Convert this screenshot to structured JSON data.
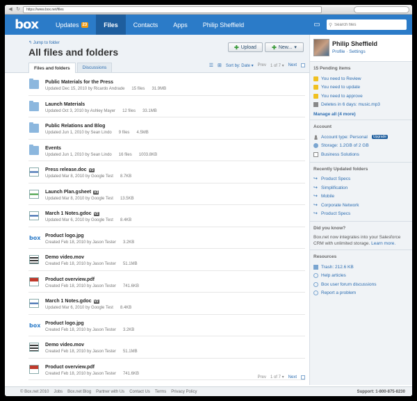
{
  "browser": {
    "url": "https://www.box.net/files"
  },
  "nav": {
    "logo": "box",
    "items": [
      {
        "label": "Updates",
        "badge": "23"
      },
      {
        "label": "Files"
      },
      {
        "label": "Contacts"
      },
      {
        "label": "Apps"
      },
      {
        "label": "Philip Sheffield"
      }
    ],
    "search_placeholder": "Search files"
  },
  "header": {
    "jump": "Jump to folder",
    "title": "All files and folders",
    "upload_label": "Upload",
    "new_label": "New...",
    "tabs": [
      "Files and folders",
      "Discussions"
    ],
    "sort_label": "Sort by: Date",
    "pager_prev": "Prev",
    "pager_page": "1 of 7",
    "pager_next": "Next"
  },
  "files": [
    {
      "name": "Public Materials for the Press",
      "meta": "Updated Dec 15, 2010 by Ricardo Andrade",
      "count": "15 files",
      "size": "31.9MB",
      "type": "folder"
    },
    {
      "name": "Launch Materials",
      "meta": "Updated Oct 3, 2010 by Ashley Mayer",
      "count": "12 files",
      "size": "33.1MB",
      "type": "folder"
    },
    {
      "name": "Public Relations and Blog",
      "meta": "Updated Jun 1, 2010 by Sean Lindo",
      "count": "9 files",
      "size": "4.5MB",
      "type": "folder"
    },
    {
      "name": "Events",
      "meta": "Updated Jun 1, 2010 by Sean Lindo",
      "count": "16 files",
      "size": "1003.8KB",
      "type": "folder"
    },
    {
      "name": "Press release.doc",
      "version": "V3",
      "meta": "Updated Mar 8, 2010 by Google Test",
      "size": "8.7KB",
      "type": "word"
    },
    {
      "name": "Launch Plan.gsheet",
      "version": "V3",
      "meta": "Updated Mar 8, 2010 by Google Test",
      "size": "13.5KB",
      "type": "sheet"
    },
    {
      "name": "March 1 Notes.gdoc",
      "version": "V2",
      "meta": "Updated Mar 6, 2010 by Google Test",
      "size": "8.4KB",
      "type": "word"
    },
    {
      "name": "Product logo.jpg",
      "meta": "Created Feb 18, 2010 by Jason Tester",
      "size": "3.2KB",
      "type": "box"
    },
    {
      "name": "Demo video.mov",
      "meta": "Created Feb 18, 2010 by Jason Tester",
      "size": "51.1MB",
      "type": "video"
    },
    {
      "name": "Product overview.pdf",
      "meta": "Created Feb 18, 2010 by Jason Tester",
      "size": "741.6KB",
      "type": "pdf"
    },
    {
      "name": "March 1 Notes.gdoc",
      "version": "V2",
      "meta": "Updated Mar 6, 2010 by Google Test",
      "size": "8.4KB",
      "type": "word"
    },
    {
      "name": "Product logo.jpg",
      "meta": "Created Feb 18, 2010 by Jason Tester",
      "size": "3.2KB",
      "type": "box"
    },
    {
      "name": "Demo video.mov",
      "meta": "Created Feb 18, 2010 by Jason Tester",
      "size": "51.1MB",
      "type": "video"
    },
    {
      "name": "Product overview.pdf",
      "meta": "Created Feb 18, 2010 by Jason Tester",
      "size": "741.6KB",
      "type": "pdf"
    }
  ],
  "sidebar": {
    "profile": {
      "name": "Philip Sheffield",
      "profile_link": "Profile",
      "settings_link": "Settings"
    },
    "pending": {
      "title": "15 Pending items",
      "items": [
        "You need to Review",
        "You need to update",
        "You need to approve",
        "Deletes in 6 days: music.mp3"
      ],
      "manage": "Manage all (4 more)"
    },
    "account": {
      "title": "Account",
      "type": "Account type: Personal",
      "upgrade": "Upgrade",
      "storage": "Storage: 1.2GB of 2 GB",
      "business": "Business Solutions"
    },
    "recent": {
      "title": "Recently Updated folders",
      "items": [
        "Product Specs",
        "Simplification",
        "Mobile",
        "Corporate Network",
        "Product Specs"
      ]
    },
    "didyouknow": {
      "title": "Did you know?",
      "text": "Box.net now integrates into your Salesforce CRM with unlimited storage.",
      "link": "Learn more."
    },
    "resources": {
      "title": "Resources",
      "items": [
        "Trash: 212.6 KB",
        "Help articles",
        "Box user forum discussions",
        "Report a problem"
      ]
    }
  },
  "footer": {
    "links": [
      "© Box.net 2010",
      "Jobs",
      "Box.net Blog",
      "Partner with Us",
      "Contact Us",
      "Terms",
      "Privacy Policy"
    ],
    "support": "Support: 1-800-875-8230"
  }
}
